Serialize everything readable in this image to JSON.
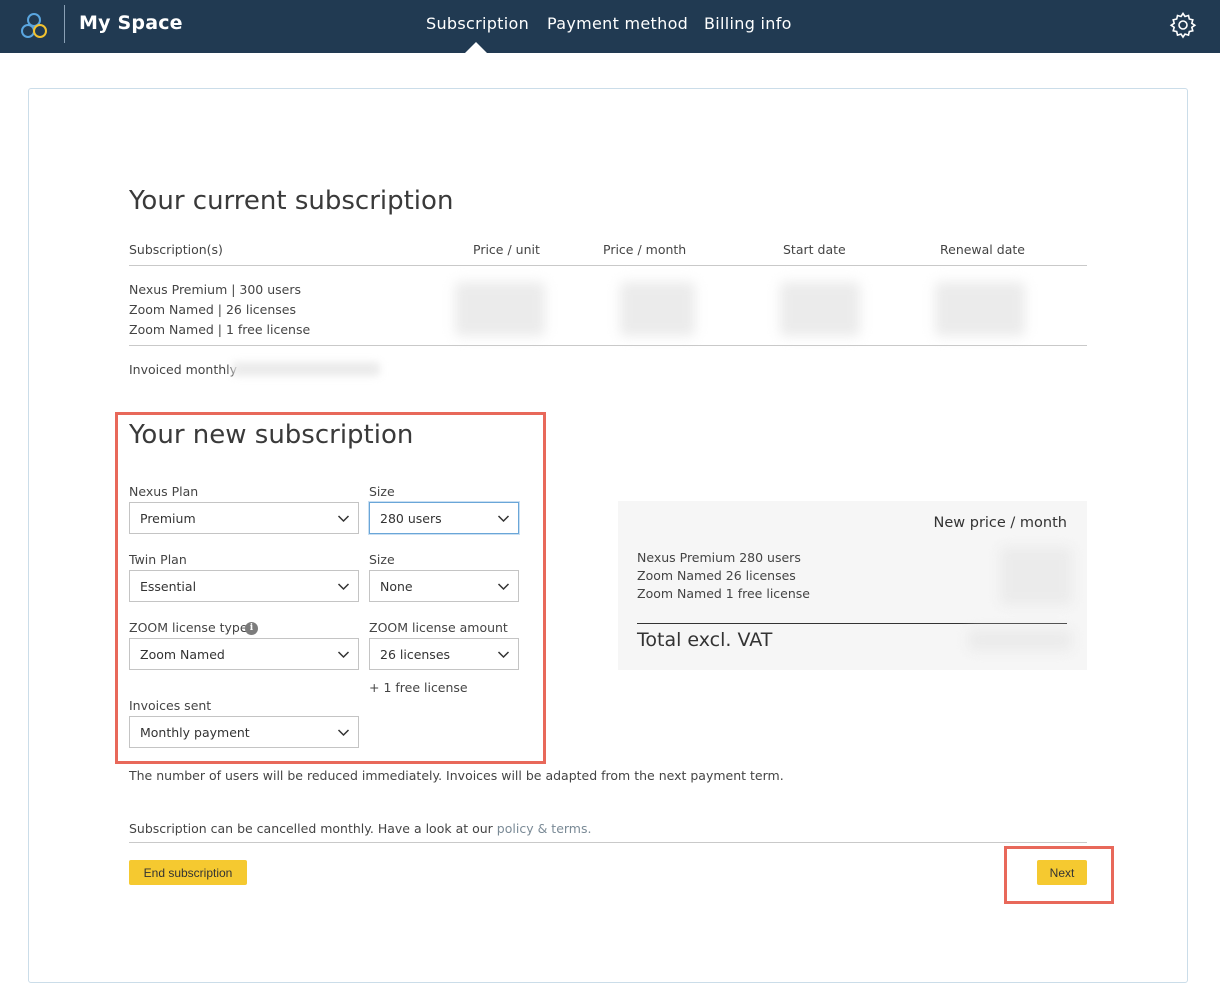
{
  "header": {
    "app_title": "My Space",
    "nav": [
      {
        "label": "Subscription",
        "active": true
      },
      {
        "label": "Payment method",
        "active": false
      },
      {
        "label": "Billing info",
        "active": false
      }
    ],
    "background_color": "#213a52"
  },
  "current": {
    "title": "Your current subscription",
    "columns": [
      "Subscription(s)",
      "Price / unit",
      "Price / month",
      "Start date",
      "Renewal date"
    ],
    "items": [
      "Nexus Premium | 300 users",
      "Zoom Named | 26 licenses",
      "Zoom Named | 1 free license"
    ],
    "invoiced": "Invoiced monthly"
  },
  "new_subscription": {
    "title": "Your new subscription",
    "fields": {
      "nexus_plan": {
        "label": "Nexus Plan",
        "value": "Premium"
      },
      "nexus_size": {
        "label": "Size",
        "value": "280 users"
      },
      "twin_plan": {
        "label": "Twin Plan",
        "value": "Essential"
      },
      "twin_size": {
        "label": "Size",
        "value": "None"
      },
      "zoom_type": {
        "label": "ZOOM license type",
        "value": "Zoom Named"
      },
      "zoom_amount": {
        "label": "ZOOM license amount",
        "value": "26 licenses"
      },
      "invoices": {
        "label": "Invoices sent",
        "value": "Monthly payment"
      }
    },
    "free_license_note": "+ 1 free license",
    "reduction_note": "The number of users will be reduced immediately. Invoices will be adapted from the next payment term."
  },
  "price_panel": {
    "title": "New price / month",
    "lines": [
      "Nexus Premium 280 users",
      "Zoom Named 26 licenses",
      "Zoom Named 1 free license"
    ],
    "total_label": "Total excl. VAT"
  },
  "footer": {
    "policy_text": "Subscription can be cancelled monthly. Have a look at our",
    "policy_link": "policy & terms.",
    "end_button": "End subscription",
    "next_button": "Next"
  },
  "colors": {
    "accent_button": "#f5c930",
    "highlight": "#e8685a",
    "focus": "#6aa6d8"
  }
}
